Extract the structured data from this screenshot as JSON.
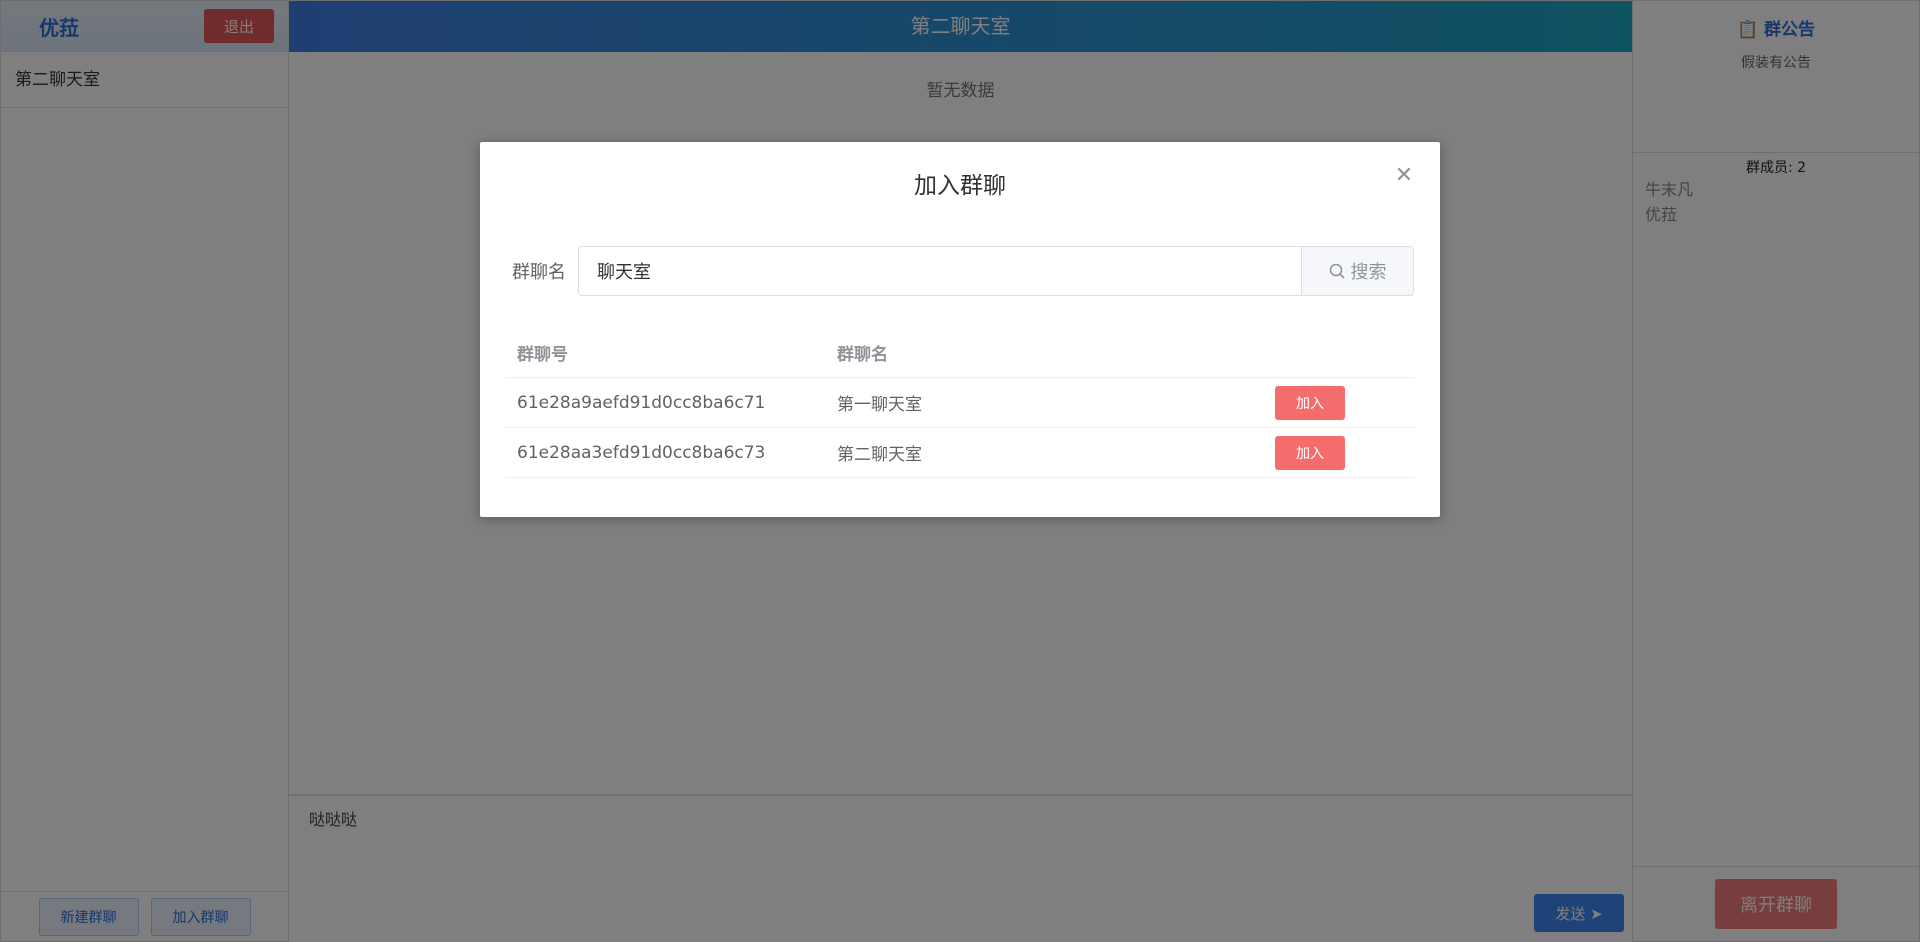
{
  "sidebar": {
    "username": "优菈",
    "logout_label": "退出",
    "rooms": [
      {
        "name": "第二聊天室"
      }
    ],
    "new_group_label": "新建群聊",
    "join_group_label": "加入群聊"
  },
  "chat": {
    "title": "第二聊天室",
    "empty_text": "暂无数据",
    "draft_text": "哒哒哒",
    "send_label": "发送"
  },
  "panel": {
    "notice_title": "群公告",
    "notice_text": "假装有公告",
    "members_label": "群成员: 2",
    "members": [
      "牛末凡",
      "优菈"
    ],
    "leave_label": "离开群聊"
  },
  "modal": {
    "title": "加入群聊",
    "search_label": "群聊名",
    "search_value": "聊天室",
    "search_button": "搜索",
    "columns": [
      "群聊号",
      "群聊名",
      ""
    ],
    "rows": [
      {
        "id": "61e28a9aefd91d0cc8ba6c71",
        "name": "第一聊天室",
        "action": "加入"
      },
      {
        "id": "61e28aa3efd91d0cc8ba6c73",
        "name": "第二聊天室",
        "action": "加入"
      }
    ]
  },
  "colors": {
    "brand": "#3e7de3",
    "danger": "#f56c6c"
  }
}
